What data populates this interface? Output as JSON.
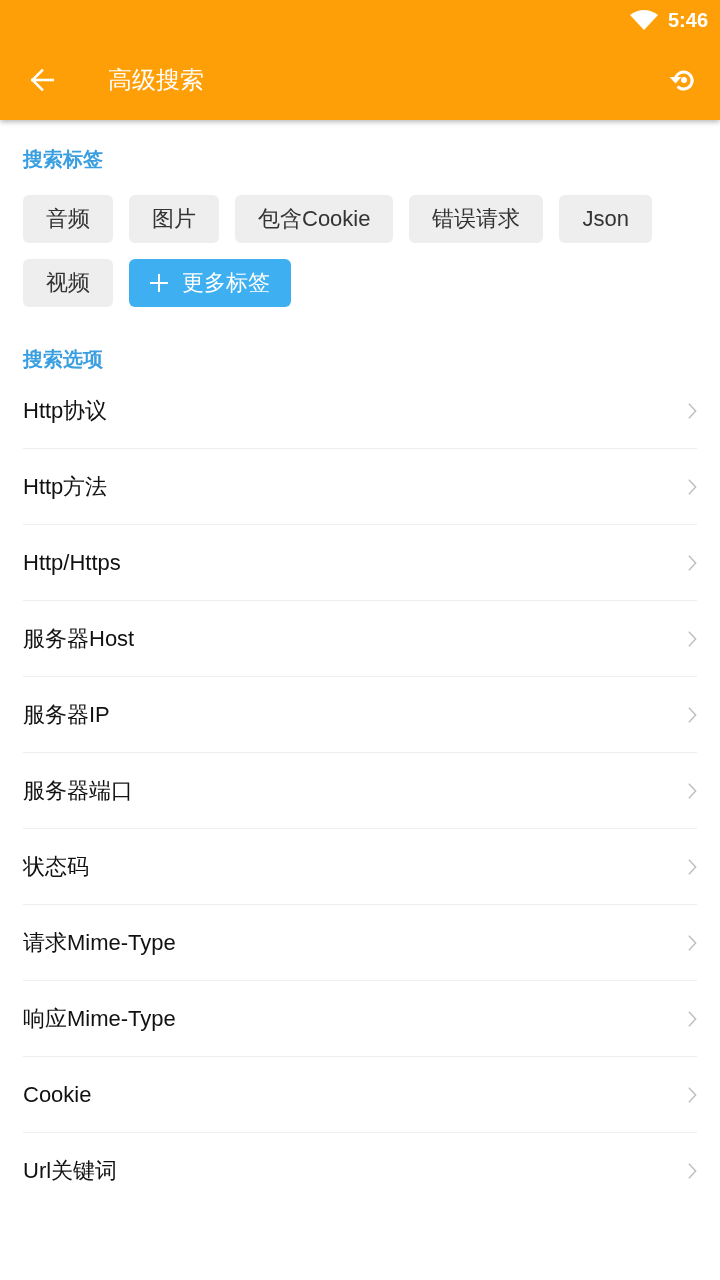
{
  "status_bar": {
    "time": "5:46"
  },
  "toolbar": {
    "title": "高级搜索"
  },
  "tag_section": {
    "title": "搜索标签",
    "tags": [
      {
        "label": "音频"
      },
      {
        "label": "图片"
      },
      {
        "label": "包含Cookie"
      },
      {
        "label": "错误请求"
      },
      {
        "label": "Json"
      },
      {
        "label": "视频"
      }
    ],
    "add_button": {
      "label": "更多标签"
    }
  },
  "option_section": {
    "title": "搜索选项",
    "items": [
      {
        "label": "Http协议"
      },
      {
        "label": "Http方法"
      },
      {
        "label": "Http/Https"
      },
      {
        "label": "服务器Host"
      },
      {
        "label": "服务器IP"
      },
      {
        "label": "服务器端口"
      },
      {
        "label": "状态码"
      },
      {
        "label": "请求Mime-Type"
      },
      {
        "label": "响应Mime-Type"
      },
      {
        "label": "Cookie"
      },
      {
        "label": "Url关键词"
      }
    ]
  }
}
